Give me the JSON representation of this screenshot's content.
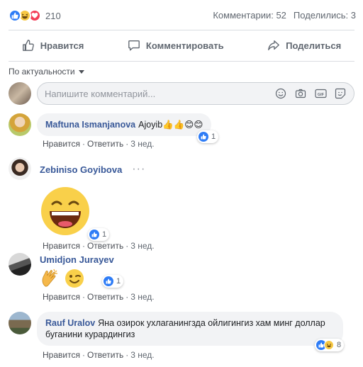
{
  "summary": {
    "reaction_count": "210",
    "comments": "Комментарии: 52",
    "shares": "Поделились: 3"
  },
  "actions": {
    "like": "Нравится",
    "comment": "Комментировать",
    "share": "Поделиться"
  },
  "sort": {
    "label": "По актуальности"
  },
  "composer": {
    "placeholder": "Напишите комментарий..."
  },
  "meta_labels": {
    "like": "Нравится",
    "reply": "Ответить",
    "time": "3 нед."
  },
  "comments": [
    {
      "author": "Maftuna Ismanjanova",
      "text": "Ajoyib👍👍😊😊",
      "reactions": "1"
    },
    {
      "author": "Zebiniso Goyibova",
      "text": "",
      "reactions": "1"
    },
    {
      "author": "Umidjon Jurayev",
      "text": "",
      "reactions": "1"
    },
    {
      "author": "Rauf Uralov",
      "text": "Яна озирок ухлаганингзда ойлигингиз хам минг доллар буганини курардингиз",
      "reactions": "8"
    }
  ],
  "colors": {
    "link": "#385898",
    "like": "#2e7cf6",
    "bubble": "#f2f3f5"
  }
}
